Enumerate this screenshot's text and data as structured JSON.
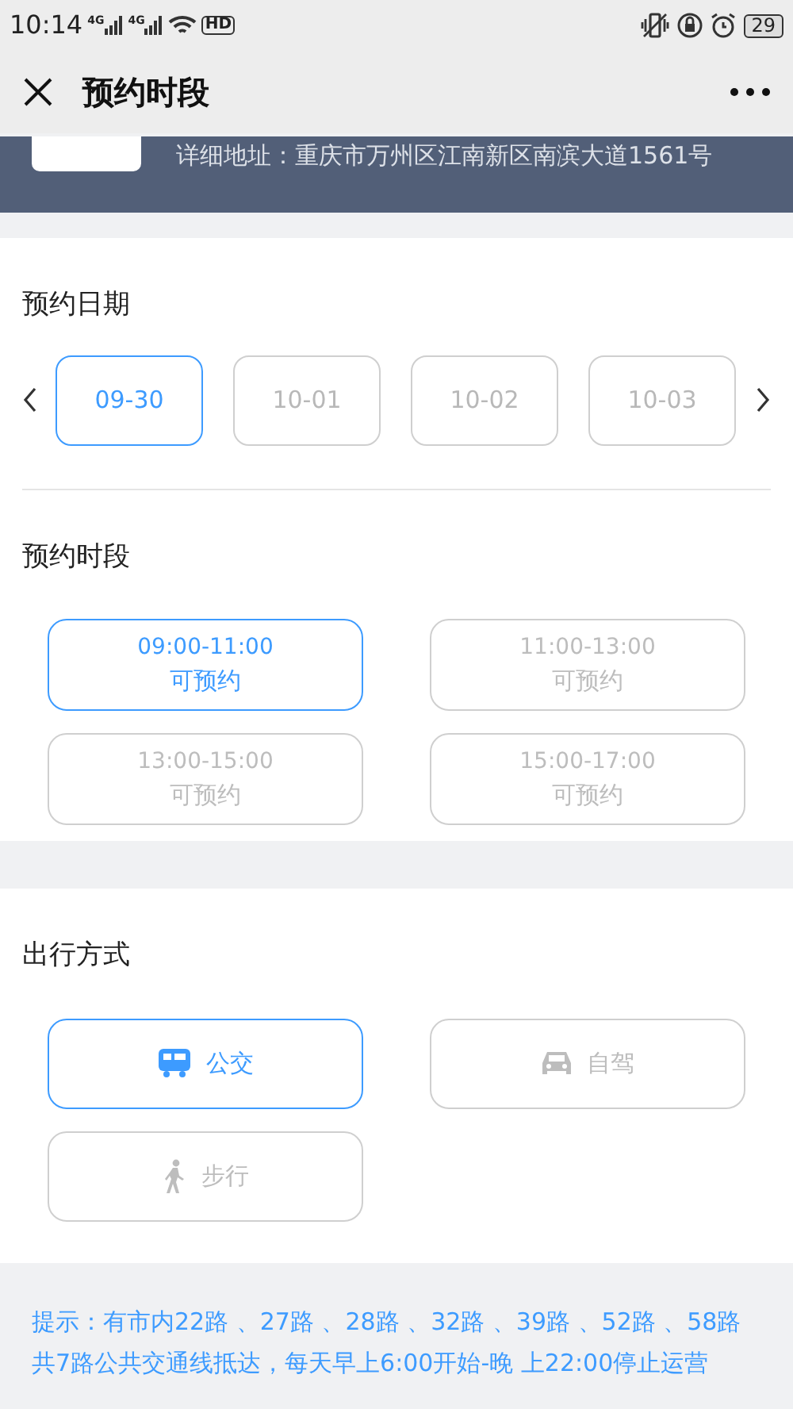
{
  "status_bar": {
    "time": "10:14",
    "network_labels": [
      "4G",
      "4G"
    ],
    "hd_label": "HD",
    "battery": "29"
  },
  "nav": {
    "title": "预约时段"
  },
  "header": {
    "address": "详细地址：重庆市万州区江南新区南滨大道1561号"
  },
  "date_section": {
    "title": "预约日期",
    "dates": [
      {
        "label": "09-30",
        "selected": true
      },
      {
        "label": "10-01",
        "selected": false
      },
      {
        "label": "10-02",
        "selected": false
      },
      {
        "label": "10-03",
        "selected": false
      }
    ]
  },
  "slot_section": {
    "title": "预约时段",
    "slots": [
      {
        "time": "09:00-11:00",
        "status": "可预约",
        "selected": true
      },
      {
        "time": "11:00-13:00",
        "status": "可预约",
        "selected": false
      },
      {
        "time": "13:00-15:00",
        "status": "可预约",
        "selected": false
      },
      {
        "time": "15:00-17:00",
        "status": "可预约",
        "selected": false
      }
    ]
  },
  "travel_section": {
    "title": "出行方式",
    "modes": [
      {
        "kind": "bus",
        "label": "公交",
        "selected": true
      },
      {
        "kind": "car",
        "label": "自驾",
        "selected": false
      },
      {
        "kind": "walk",
        "label": "步行",
        "selected": false
      }
    ]
  },
  "tip": "提示：有市内22路 、27路 、28路 、32路 、39路 、52路 、58路共7路公共交通线抵达，每天早上6:00开始-晚 上22:00停止运营"
}
